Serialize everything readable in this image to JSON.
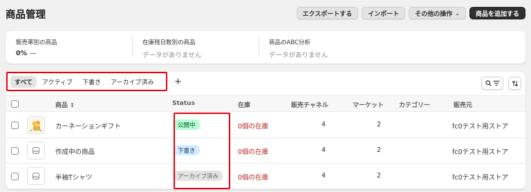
{
  "page": {
    "title": "商品管理"
  },
  "actions": {
    "export": "エクスポートする",
    "import": "インポート",
    "more": "その他の操作",
    "add": "商品を追加する"
  },
  "stats": [
    {
      "label": "販売率別の商品",
      "value": "0%",
      "extra": "—"
    },
    {
      "label": "在庫残日数別の商品",
      "value": "データがありません"
    },
    {
      "label": "商品のABC分析",
      "value": "データがありません"
    }
  ],
  "tabs": {
    "all": "すべて",
    "active": "アクティブ",
    "draft": "下書き",
    "archived": "アーカイブ済み",
    "add": "+"
  },
  "columns": {
    "product": "商品",
    "status": "Status",
    "inventory": "在庫",
    "channels": "販売チャネル",
    "markets": "マーケット",
    "category": "カテゴリー",
    "vendor": "販売元"
  },
  "rows": [
    {
      "name": "カーネーションギフト",
      "status": "公開中",
      "inventory": "0個の在庫",
      "channels": "4",
      "markets": "2",
      "vendor": "fc0テスト用ストア",
      "thumb": "carnation-image"
    },
    {
      "name": "作成中の商品",
      "status": "下書き",
      "inventory": "0個の在庫",
      "channels": "4",
      "markets": "2",
      "vendor": "fc0テスト用ストア",
      "thumb": "image-placeholder-icon"
    },
    {
      "name": "半袖Tシャツ",
      "status": "アーカイブ済み",
      "inventory": "0個の在庫",
      "channels": "4",
      "markets": "2",
      "vendor": "fc0テスト用ストア",
      "thumb": "image-placeholder-icon"
    }
  ],
  "colors": {
    "highlight": "#e8000b",
    "active_badge_bg": "#b4fed2",
    "draft_badge_bg": "#d5ebff",
    "archived_badge_bg": "#e3e3e3",
    "inventory_text": "#b3261e"
  }
}
